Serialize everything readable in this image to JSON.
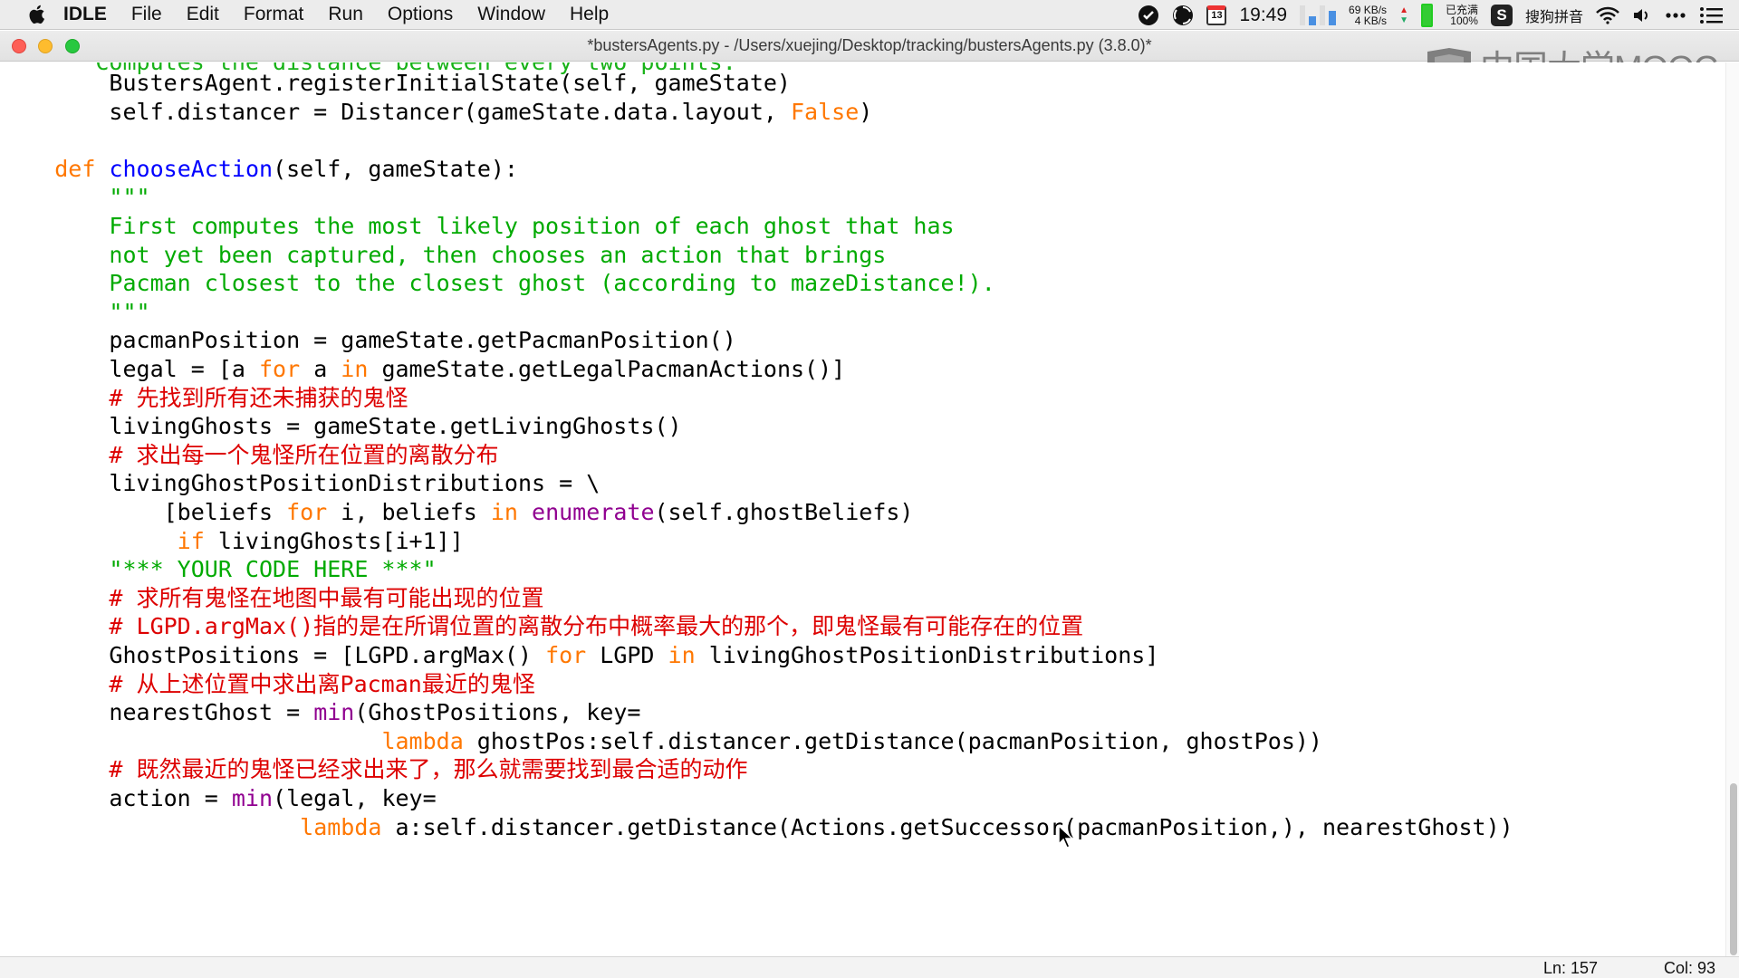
{
  "menubar": {
    "apple_icon": "apple-logo-icon",
    "items": [
      "IDLE",
      "File",
      "Edit",
      "Format",
      "Run",
      "Options",
      "Window",
      "Help"
    ],
    "status": {
      "calendar_day": "13",
      "clock": "19:49",
      "net_up": "69 KB/s",
      "net_down": "4 KB/s",
      "battery_label": "已充满",
      "battery_pct": "100%",
      "ime_label": "搜狗拼音"
    }
  },
  "window": {
    "title": "*bustersAgents.py - /Users/xuejing/Desktop/tracking/bustersAgents.py (3.8.0)*"
  },
  "watermark": {
    "text": "中国大学MOOC"
  },
  "code": {
    "partial_top": "    '''Computes the distance between every two points.'''",
    "lines": [
      [
        {
          "t": "        BustersAgent.registerInitialState(self, gameState)"
        }
      ],
      [
        {
          "t": "        self.distancer = Distancer(gameState.data.layout, "
        },
        {
          "t": "False",
          "c": "kw"
        },
        {
          "t": ")"
        }
      ],
      [
        {
          "t": ""
        }
      ],
      [
        {
          "t": "    "
        },
        {
          "t": "def",
          "c": "kw"
        },
        {
          "t": " "
        },
        {
          "t": "chooseAction",
          "c": "def"
        },
        {
          "t": "(self, gameState):"
        }
      ],
      [
        {
          "t": "        \"\"\"",
          "c": "str"
        }
      ],
      [
        {
          "t": "        First computes the most likely position of each ghost that has",
          "c": "str"
        }
      ],
      [
        {
          "t": "        not yet been captured, then chooses an action that brings",
          "c": "str"
        }
      ],
      [
        {
          "t": "        Pacman closest to the closest ghost (according to mazeDistance!).",
          "c": "str"
        }
      ],
      [
        {
          "t": "        \"\"\"",
          "c": "str"
        }
      ],
      [
        {
          "t": "        pacmanPosition = gameState.getPacmanPosition()"
        }
      ],
      [
        {
          "t": "        legal = [a "
        },
        {
          "t": "for",
          "c": "kw"
        },
        {
          "t": " a "
        },
        {
          "t": "in",
          "c": "kw"
        },
        {
          "t": " gameState.getLegalPacmanActions()]"
        }
      ],
      [
        {
          "t": "        # 先找到所有还未捕获的鬼怪",
          "c": "com"
        }
      ],
      [
        {
          "t": "        livingGhosts = gameState.getLivingGhosts()"
        }
      ],
      [
        {
          "t": "        # 求出每一个鬼怪所在位置的离散分布",
          "c": "com"
        }
      ],
      [
        {
          "t": "        livingGhostPositionDistributions = \\"
        }
      ],
      [
        {
          "t": "            [beliefs "
        },
        {
          "t": "for",
          "c": "kw"
        },
        {
          "t": " i, beliefs "
        },
        {
          "t": "in",
          "c": "kw"
        },
        {
          "t": " "
        },
        {
          "t": "enumerate",
          "c": "bi"
        },
        {
          "t": "(self.ghostBeliefs)"
        }
      ],
      [
        {
          "t": "             "
        },
        {
          "t": "if",
          "c": "kw"
        },
        {
          "t": " livingGhosts[i+1]]"
        }
      ],
      [
        {
          "t": "        \"*** YOUR CODE HERE ***\"",
          "c": "str"
        }
      ],
      [
        {
          "t": "        # 求所有鬼怪在地图中最有可能出现的位置",
          "c": "com"
        }
      ],
      [
        {
          "t": "        # LGPD.argMax()指的是在所谓位置的离散分布中概率最大的那个，即鬼怪最有可能存在的位置",
          "c": "com"
        }
      ],
      [
        {
          "t": "        GhostPositions = [LGPD.argMax() "
        },
        {
          "t": "for",
          "c": "kw"
        },
        {
          "t": " LGPD "
        },
        {
          "t": "in",
          "c": "kw"
        },
        {
          "t": " livingGhostPositionDistributions]"
        }
      ],
      [
        {
          "t": "        # 从上述位置中求出离Pacman最近的鬼怪",
          "c": "com"
        }
      ],
      [
        {
          "t": "        nearestGhost = "
        },
        {
          "t": "min",
          "c": "bi"
        },
        {
          "t": "(GhostPositions, key="
        }
      ],
      [
        {
          "t": "                            "
        },
        {
          "t": "lambda",
          "c": "kw"
        },
        {
          "t": " ghostPos:self.distancer.getDistance(pacmanPosition, ghostPos))"
        }
      ],
      [
        {
          "t": "        # 既然最近的鬼怪已经求出来了，那么就需要找到最合适的动作",
          "c": "com"
        }
      ],
      [
        {
          "t": "        action = "
        },
        {
          "t": "min",
          "c": "bi"
        },
        {
          "t": "(legal, key="
        }
      ],
      [
        {
          "t": "                      "
        },
        {
          "t": "lambda",
          "c": "kw"
        },
        {
          "t": " a:self.distancer.getDistance(Actions.getSuccessor(pacmanPosition,), nearestGhost))"
        }
      ]
    ]
  },
  "statusbar": {
    "line": "Ln: 157",
    "column": "Col: 93"
  }
}
